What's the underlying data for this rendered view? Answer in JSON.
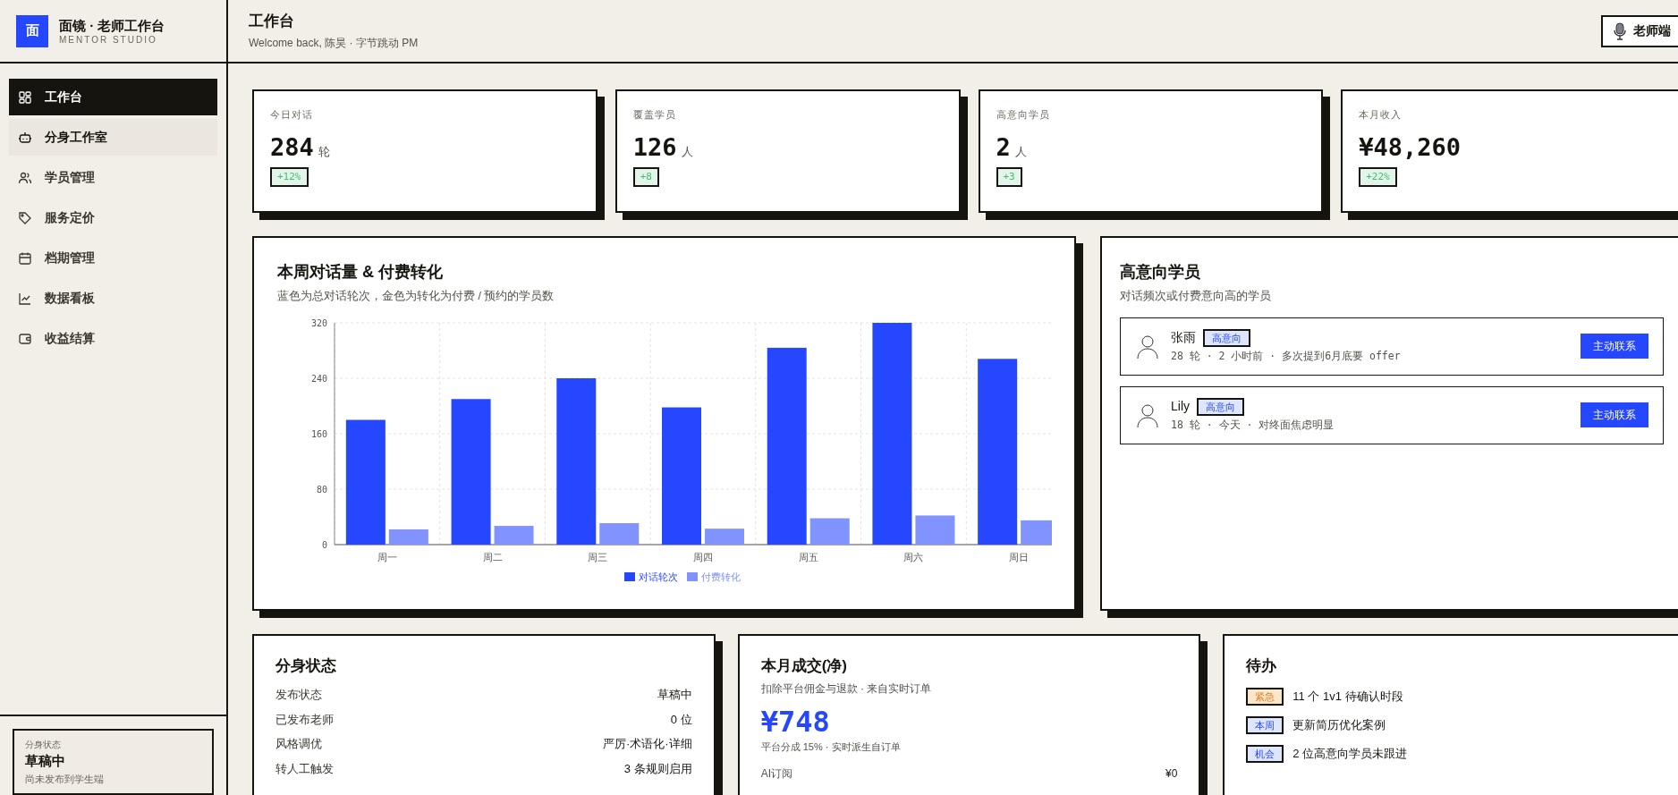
{
  "brand": {
    "logo": "面",
    "title": "面镜 · 老师工作台",
    "subtitle": "MENTOR STUDIO"
  },
  "sidebar": {
    "items": [
      {
        "label": "工作台",
        "selected": true,
        "hovered": false
      },
      {
        "label": "分身工作室",
        "selected": false,
        "hovered": true
      },
      {
        "label": "学员管理",
        "selected": false,
        "hovered": false
      },
      {
        "label": "服务定价",
        "selected": false,
        "hovered": false
      },
      {
        "label": "档期管理",
        "selected": false,
        "hovered": false
      },
      {
        "label": "数据看板",
        "selected": false,
        "hovered": false
      },
      {
        "label": "收益结算",
        "selected": false,
        "hovered": false
      }
    ],
    "status_card": {
      "label": "分身状态",
      "value": "草稿中",
      "note": "尚未发布到学生端"
    }
  },
  "header": {
    "title": "工作台",
    "subtitle": "Welcome back, 陈昊 · 字节跳动 PM",
    "role_button": "老师端"
  },
  "stats": [
    {
      "label": "今日对话",
      "value": "284",
      "unit": "轮",
      "delta": "+12%"
    },
    {
      "label": "覆盖学员",
      "value": "126",
      "unit": "人",
      "delta": "+8"
    },
    {
      "label": "高意向学员",
      "value": "2",
      "unit": "人",
      "delta": "+3"
    },
    {
      "label": "本月收入",
      "value": "¥48,260",
      "delta": "+22%"
    }
  ],
  "weekly_chart": {
    "title": "本周对话量 & 付费转化",
    "subtitle": "蓝色为总对话轮次，金色为转化为付费 / 预约的学员数",
    "chart_data": {
      "type": "bar",
      "categories": [
        "周一",
        "周二",
        "周三",
        "周四",
        "周五",
        "周六",
        "周日"
      ],
      "series": [
        {
          "name": "对话轮次",
          "color": "#2447ff",
          "values": [
            180,
            210,
            240,
            198,
            284,
            320,
            268
          ]
        },
        {
          "name": "付费转化",
          "color": "#8093ff",
          "values": [
            22,
            27,
            31,
            23,
            38,
            42,
            35
          ]
        }
      ],
      "ylim": [
        0,
        320
      ],
      "yticks": [
        0,
        80,
        160,
        240,
        320
      ],
      "grid": true,
      "legend": "bottom"
    }
  },
  "high_intent": {
    "title": "高意向学员",
    "subtitle": "对话频次或付费意向高的学员",
    "students": [
      {
        "name": "张雨",
        "tag": "高意向",
        "meta": "28 轮 · 2 小时前 · 多次提到6月底要 offer",
        "action": "主动联系"
      },
      {
        "name": "Lily",
        "tag": "高意向",
        "meta": "18 轮 · 今天 · 对终面焦虑明显",
        "action": "主动联系"
      }
    ]
  },
  "avatar_status": {
    "title": "分身状态",
    "rows": [
      {
        "label": "发布状态",
        "value": "草稿中"
      },
      {
        "label": "已发布老师",
        "value": "0 位"
      },
      {
        "label": "风格调优",
        "value": "严厉·术语化·详细"
      },
      {
        "label": "转人工触发",
        "value": "3 条规则启用"
      }
    ]
  },
  "monthly_deals": {
    "title": "本月成交(净)",
    "subtitle": "扣除平台佣金与退款 · 来自实时订单",
    "amount": "¥748",
    "note": "平台分成 15% · 实时派生自订单",
    "rows": [
      {
        "label": "AI订阅",
        "value": "¥0"
      }
    ]
  },
  "todos": {
    "title": "待办",
    "items": [
      {
        "tag": "紧急",
        "color": "#fbe6c9",
        "kind": "urgent",
        "text": "11 个 1v1 待确认时段"
      },
      {
        "tag": "本周",
        "color": "#dde5ff",
        "kind": "plan",
        "text": "更新简历优化案例"
      },
      {
        "tag": "机会",
        "color": "#dde5ff",
        "kind": "plan",
        "text": "2 位高意向学员未跟进"
      }
    ]
  }
}
